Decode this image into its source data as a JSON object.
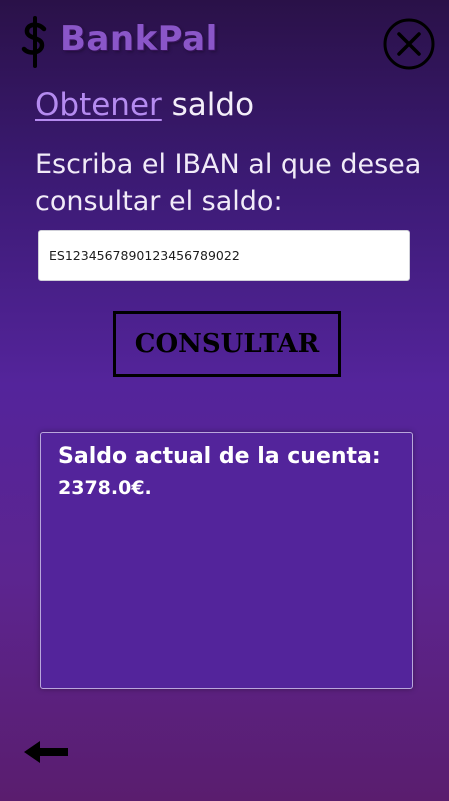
{
  "app": {
    "brand": "BankPal",
    "logo_icon": "currency-logo-icon",
    "close_icon": "close-circle-icon"
  },
  "page": {
    "title_link": "Obtener",
    "title_rest": " saldo",
    "prompt": "Escriba el IBAN al que desea consultar el saldo:"
  },
  "form": {
    "iban_value": "ES1234567890123456789022",
    "consult_label": "CONSULTAR"
  },
  "result": {
    "label": "Saldo actual de la cuenta:",
    "value": "2378.0€."
  },
  "nav": {
    "back_icon": "arrow-left-icon"
  },
  "colors": {
    "accent": "#b58bf0",
    "brand": "#8a56c8",
    "result_background": "#53249b"
  }
}
